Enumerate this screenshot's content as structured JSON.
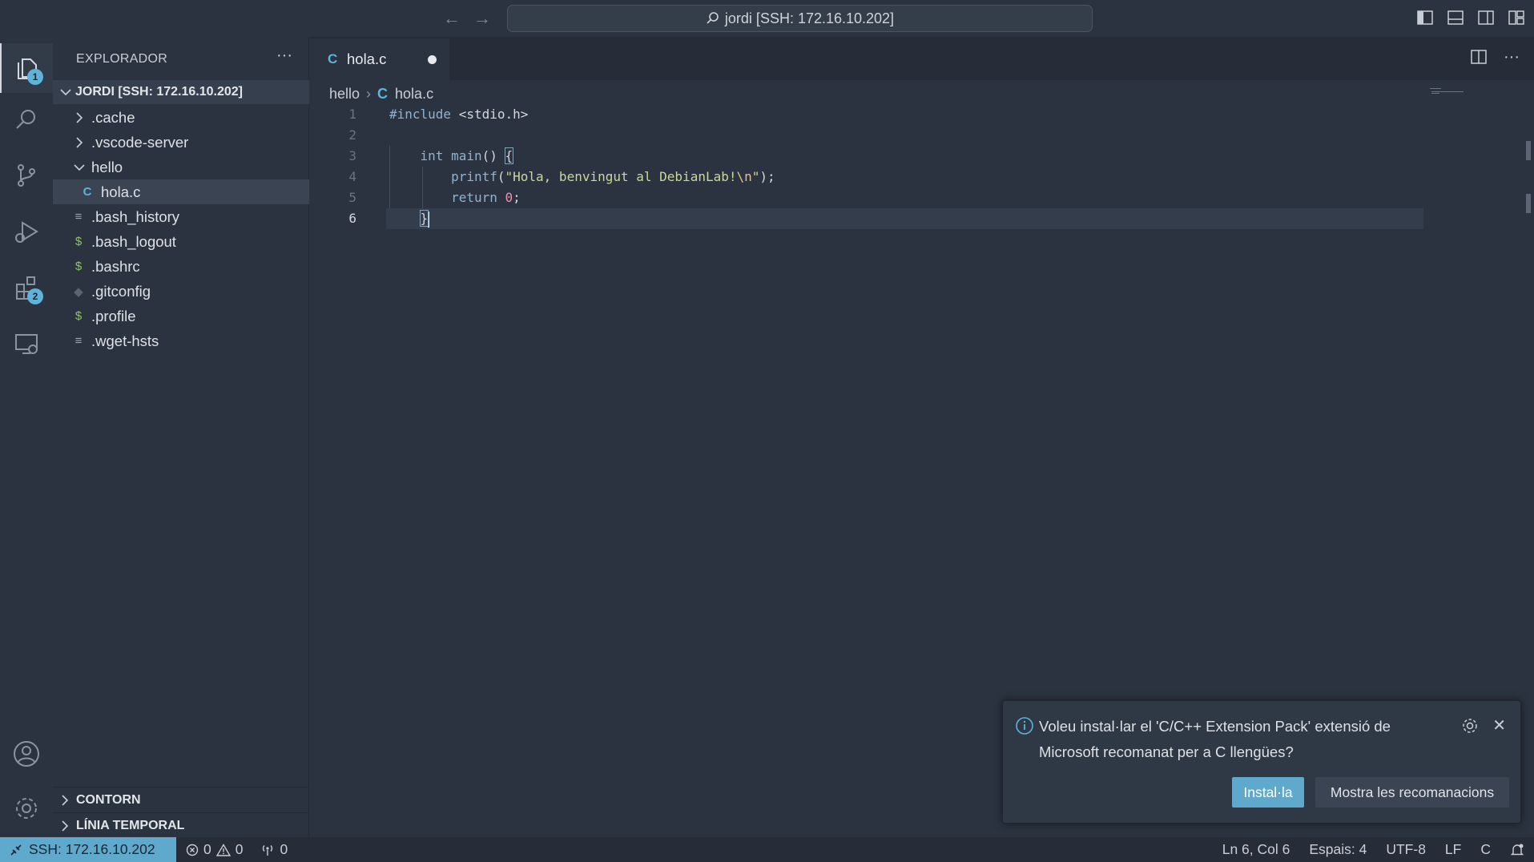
{
  "titlebar": {
    "search_text": "jordi [SSH: 172.16.10.202]"
  },
  "activity": {
    "explorer_badge": "1",
    "extensions_badge": "2"
  },
  "sidebar": {
    "title": "EXPLORADOR",
    "more": "···",
    "root": "JORDI [SSH: 172.16.10.202]",
    "items": [
      {
        "label": ".cache",
        "icon": "chevron-right-icon"
      },
      {
        "label": ".vscode-server",
        "icon": "chevron-right-icon"
      },
      {
        "label": "hello",
        "icon": "chevron-down-icon"
      },
      {
        "label": "hola.c",
        "icon": "c-file-icon",
        "icon_text": "C"
      },
      {
        "label": ".bash_history",
        "icon": "text-file-icon",
        "icon_text": "≡"
      },
      {
        "label": ".bash_logout",
        "icon": "shell-file-icon",
        "icon_text": "$"
      },
      {
        "label": ".bashrc",
        "icon": "shell-file-icon",
        "icon_text": "$"
      },
      {
        "label": ".gitconfig",
        "icon": "git-file-icon",
        "icon_text": "◆"
      },
      {
        "label": ".profile",
        "icon": "shell-file-icon",
        "icon_text": "$"
      },
      {
        "label": ".wget-hsts",
        "icon": "text-file-icon",
        "icon_text": "≡"
      }
    ],
    "sections": {
      "outline": "CONTORN",
      "timeline": "LÍNIA TEMPORAL"
    }
  },
  "editor": {
    "tab": {
      "icon_text": "C",
      "name": "hola.c"
    },
    "breadcrumb": {
      "folder": "hello",
      "icon_text": "C",
      "file": "hola.c"
    },
    "lines": [
      "1",
      "2",
      "3",
      "4",
      "5",
      "6"
    ],
    "code": {
      "l1_pp": "#include",
      "l1_rest": " <stdio.h>",
      "l3_kw": "int",
      "l3_fn": " main",
      "l3_rest": "() ",
      "l3_brace": "{",
      "l4_fn": "printf",
      "l4_open": "(",
      "l4_str": "\"Hola, benvingut al DebianLab!",
      "l4_esc": "\\n",
      "l4_strend": "\"",
      "l4_close": ");",
      "l5_kw": "return",
      "l5_num": "0",
      "l5_end": ";",
      "l6_brace": "}"
    }
  },
  "notification": {
    "message": "Voleu instal·lar el 'C/C++ Extension Pack' extensió de Microsoft recomanat per a C llengües?",
    "install": "Instal·la",
    "recommendations": "Mostra les recomanacions"
  },
  "status": {
    "remote": "SSH: 172.16.10.202",
    "errors": "0",
    "warnings": "0",
    "ports": "0",
    "position": "Ln 6, Col 6",
    "spaces": "Espais: 4",
    "encoding": "UTF-8",
    "eol": "LF",
    "language": "C"
  },
  "colors": {
    "accent": "#5fa9cc",
    "background": "#2b3340"
  }
}
